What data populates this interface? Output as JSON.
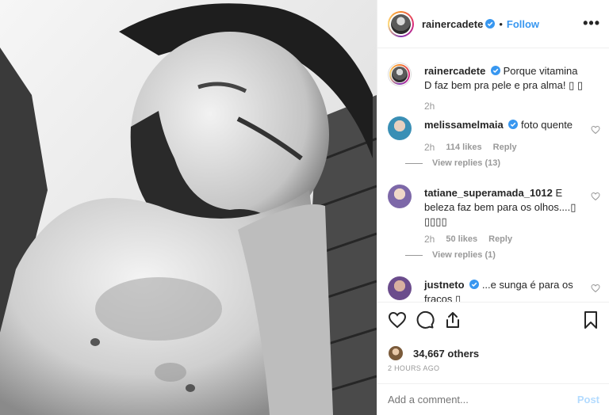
{
  "header": {
    "username": "rainercadete",
    "follow_label": "Follow",
    "dot": "•",
    "more": "•••"
  },
  "caption": {
    "username": "rainercadete",
    "text": "Porque vitamina D faz bem pra pele e pra alma! ▯ ▯",
    "time": "2h"
  },
  "comments": [
    {
      "username": "melissamelmaia",
      "verified": true,
      "text": "foto quente",
      "time": "2h",
      "likes": "114 likes",
      "reply_label": "Reply",
      "view_replies": "View replies (13)",
      "avatar_color": "#3a8fb5"
    },
    {
      "username": "tatiane_superamada_1012",
      "verified": false,
      "text": "E beleza faz bem para os olhos....▯ ▯▯▯▯",
      "time": "2h",
      "likes": "50 likes",
      "reply_label": "Reply",
      "view_replies": "View replies (1)",
      "avatar_color": "#7d68a8"
    },
    {
      "username": "justneto",
      "verified": true,
      "text": "...e sunga é para os fracos ▯",
      "avatar_color": "#6b4c8c"
    }
  ],
  "actions": {
    "like_icon": "heart-icon",
    "comment_icon": "comment-icon",
    "share_icon": "share-icon",
    "save_icon": "bookmark-icon"
  },
  "likes_text": "34,667 others",
  "time_ago": "2 HOURS AGO",
  "add_comment": {
    "placeholder": "Add a comment...",
    "post_label": "Post"
  },
  "colors": {
    "accent": "#3897f0",
    "verified": "#3897f0",
    "muted": "#999999",
    "post_disabled": "#b3dbff"
  }
}
